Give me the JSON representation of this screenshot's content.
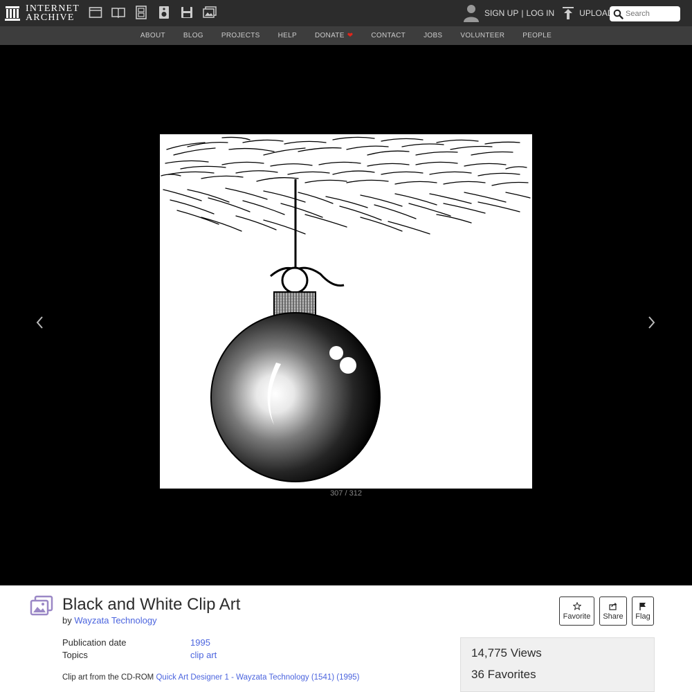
{
  "header": {
    "logo_line1": "INTERNET",
    "logo_line2": "ARCHIVE",
    "media_icons": [
      "web-icon",
      "texts-icon",
      "video-icon",
      "audio-icon",
      "software-icon",
      "images-icon"
    ],
    "sign_up_label": "SIGN UP",
    "separator": "|",
    "log_in_label": "LOG IN",
    "upload_label": "UPLOAD",
    "search_placeholder": "Search"
  },
  "nav": {
    "items": [
      "ABOUT",
      "BLOG",
      "PROJECTS",
      "HELP",
      "DONATE",
      "CONTACT",
      "JOBS",
      "VOLUNTEER",
      "PEOPLE"
    ],
    "donate_icon": "heart-icon"
  },
  "viewer": {
    "page_counter": "307 / 312",
    "prev_icon": "chevron-left-icon",
    "next_icon": "chevron-right-icon"
  },
  "item": {
    "title": "Black and White Clip Art",
    "by_prefix": "by",
    "creator": "Wayzata Technology",
    "publication_date_label": "Publication date",
    "publication_date": "1995",
    "topics_label": "Topics",
    "topics": "clip art",
    "description_prefix": "Clip art from the CD-ROM",
    "description_link": "Quick Art Designer 1 - Wayzata Technology (1541) (1995)"
  },
  "actions": {
    "favorite_label": "Favorite",
    "share_label": "Share",
    "flag_label": "Flag"
  },
  "stats": {
    "views_count": "14,775",
    "views_label": "Views",
    "favorites_count": "36",
    "favorites_label": "Favorites"
  },
  "colors": {
    "topbar": "#2c2c2c",
    "subnav": "#3d3d3d",
    "link": "#4b64de",
    "donate_heart": "#e0261b",
    "type_icon": "#9b88c6"
  }
}
